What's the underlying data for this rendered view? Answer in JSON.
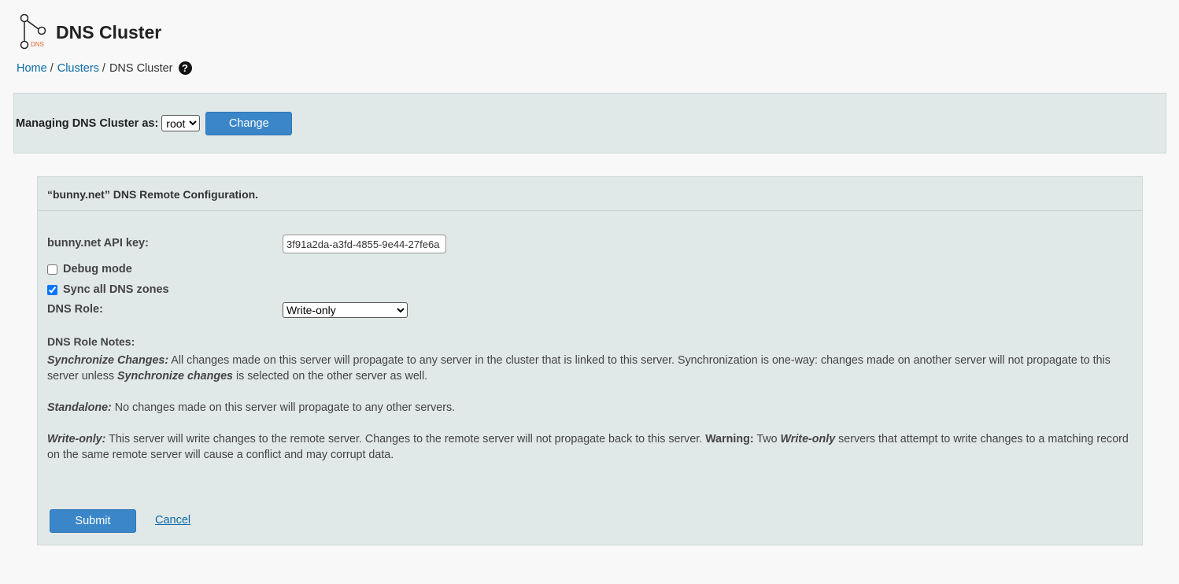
{
  "header": {
    "title": "DNS Cluster",
    "logo_text": "DNS",
    "logo_icon": "cluster-nodes-icon"
  },
  "breadcrumb": {
    "home": "Home",
    "clusters": "Clusters",
    "current": "DNS Cluster",
    "separator": "/",
    "help_icon": "question-circle-icon",
    "help_glyph": "?"
  },
  "manage": {
    "label": "Managing DNS Cluster as:",
    "selected_user": "root",
    "change_label": "Change"
  },
  "config": {
    "title": "“bunny.net” DNS Remote Configuration.",
    "api_key_label": "bunny.net API key:",
    "api_key_value": "3f91a2da-a3fd-4855-9e44-27fe6a",
    "debug_label": "Debug mode",
    "debug_checked": false,
    "sync_label": "Sync all DNS zones",
    "sync_checked": true,
    "role_label": "DNS Role:",
    "role_selected": "Write-only",
    "notes_heading": "DNS Role Notes:",
    "notes": {
      "sync_term": "Synchronize Changes:",
      "sync_text1": " All changes made on this server will propagate to any server in the cluster that is linked to this server. Synchronization is one-way: changes made on another server will not propagate to this server unless ",
      "sync_term2": "Synchronize changes",
      "sync_text2": " is selected on the other server as well.",
      "standalone_term": "Standalone:",
      "standalone_text": " No changes made on this server will propagate to any other servers.",
      "writeonly_term": "Write-only:",
      "writeonly_text1": " This server will write changes to the remote server. Changes to the remote server will not propagate back to this server. ",
      "warning_label": "Warning:",
      "writeonly_text2": " Two ",
      "writeonly_term2": "Write-only",
      "writeonly_text3": " servers that attempt to write changes to a matching record on the same remote server will cause a conflict and may corrupt data."
    },
    "submit_label": "Submit",
    "cancel_label": "Cancel"
  },
  "colors": {
    "panel_bg": "#e1e8e8",
    "button_bg": "#3a86c8",
    "link": "#0a6aa8",
    "logo_accent": "#e8632b"
  }
}
